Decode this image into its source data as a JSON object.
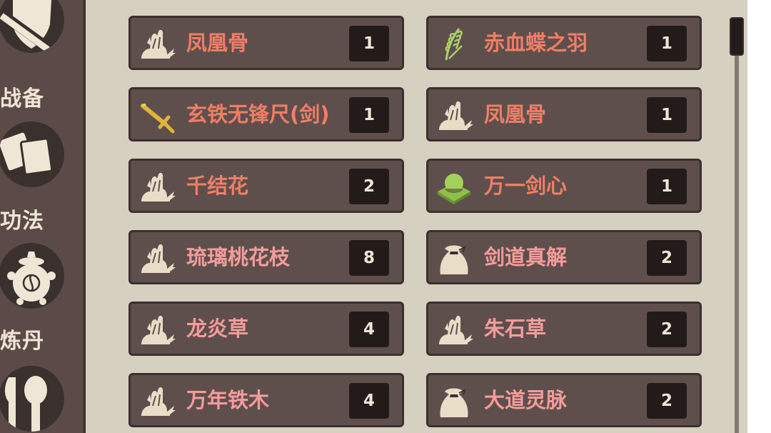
{
  "sidebar": {
    "items": [
      {
        "label": "战备",
        "icon": "shield-sword-icon"
      },
      {
        "label": "功法",
        "icon": "scroll-books-icon"
      },
      {
        "label": "炼丹",
        "icon": "alchemy-cauldron-icon"
      },
      {
        "label": "",
        "icon": "utensils-icon"
      }
    ]
  },
  "inventory": {
    "items": [
      {
        "name": "凤凰骨",
        "count": "1",
        "icon": "herb-rock-icon"
      },
      {
        "name": "赤血蝶之羽",
        "count": "1",
        "icon": "wheat-plant-icon"
      },
      {
        "name": "玄铁无锋尺(剑)",
        "count": "1",
        "icon": "sword-icon"
      },
      {
        "name": "凤凰骨",
        "count": "1",
        "icon": "herb-rock-icon"
      },
      {
        "name": "千结花",
        "count": "2",
        "icon": "herb-rock-icon"
      },
      {
        "name": "万一剑心",
        "count": "1",
        "icon": "green-orb-icon"
      },
      {
        "name": "琉璃桃花枝",
        "count": "8",
        "icon": "herb-rock-icon"
      },
      {
        "name": "剑道真解",
        "count": "2",
        "icon": "cloth-bag-icon"
      },
      {
        "name": "龙炎草",
        "count": "4",
        "icon": "herb-rock-icon"
      },
      {
        "name": "朱石草",
        "count": "2",
        "icon": "herb-rock-icon"
      },
      {
        "name": "万年铁木",
        "count": "4",
        "icon": "herb-rock-icon"
      },
      {
        "name": "大道灵脉",
        "count": "2",
        "icon": "cloth-bag-icon"
      }
    ]
  },
  "colors": {
    "sidebar_bg": "#5b4a47",
    "panel_bg": "#d6d0c1",
    "item_bg": "#5f4f4c",
    "name_orange": "#f07e66",
    "name_pink": "#f39c9c",
    "count_bg": "#231b1a",
    "label_text": "#efe6d6"
  }
}
